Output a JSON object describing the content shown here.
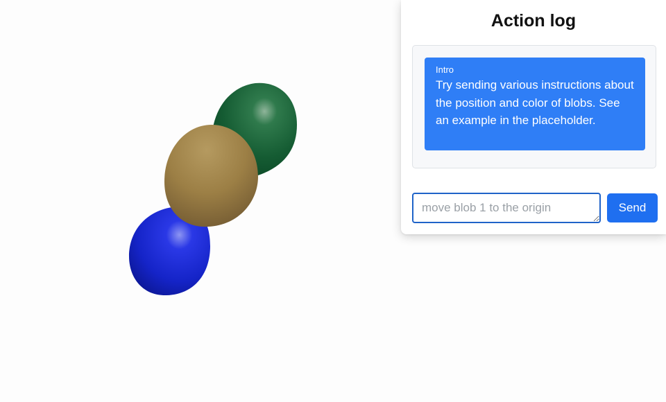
{
  "scene": {
    "blobs": [
      {
        "name": "green blob",
        "color": "#0f5a30"
      },
      {
        "name": "tan blob",
        "color": "#a8874a"
      },
      {
        "name": "blue blob",
        "color": "#1020d0"
      }
    ]
  },
  "panel": {
    "title": "Action log",
    "entries": [
      {
        "label": "Intro",
        "text": "Try sending various instructions about the position and color of blobs. See an example in the placeholder."
      }
    ]
  },
  "composer": {
    "input_value": "",
    "placeholder": "move blob 1 to the origin",
    "send_label": "Send"
  },
  "colors": {
    "accent": "#1f6ff0",
    "entry_bg": "#2f7ef6"
  }
}
